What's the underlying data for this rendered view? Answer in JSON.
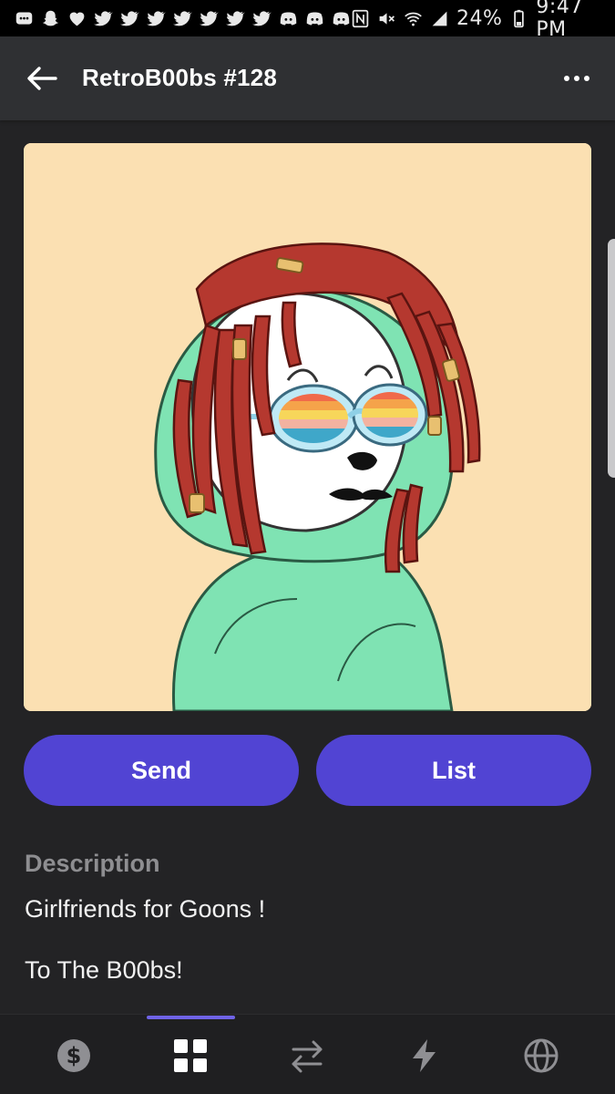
{
  "status_bar": {
    "battery": "24%",
    "time": "9:47 PM",
    "notification_icons": [
      "messages-icon",
      "snapchat-icon",
      "heart-icon",
      "twitter-icon",
      "twitter-icon",
      "twitter-icon",
      "twitter-icon",
      "twitter-icon",
      "twitter-icon",
      "twitter-icon",
      "discord-icon",
      "discord-icon",
      "discord-icon"
    ],
    "system_icons": [
      "nfc-icon",
      "mute-icon",
      "wifi-icon",
      "signal-icon",
      "battery-icon"
    ]
  },
  "header": {
    "title": "RetroB00bs #128",
    "back_icon": "arrow-left-icon",
    "more_icon": "more-horizontal-icon"
  },
  "nft": {
    "background_color": "#fbe0b2"
  },
  "actions": {
    "send_label": "Send",
    "list_label": "List",
    "button_color": "#5144d3"
  },
  "description": {
    "heading": "Description",
    "line1": "Girlfriends for Goons !",
    "line2": "To The B00bs!"
  },
  "bottom_nav": {
    "items": [
      {
        "icon": "dollar-icon",
        "active": false
      },
      {
        "icon": "grid-icon",
        "active": true
      },
      {
        "icon": "swap-icon",
        "active": false
      },
      {
        "icon": "lightning-icon",
        "active": false
      },
      {
        "icon": "globe-icon",
        "active": false
      }
    ],
    "accent_color": "#6f63e6"
  }
}
